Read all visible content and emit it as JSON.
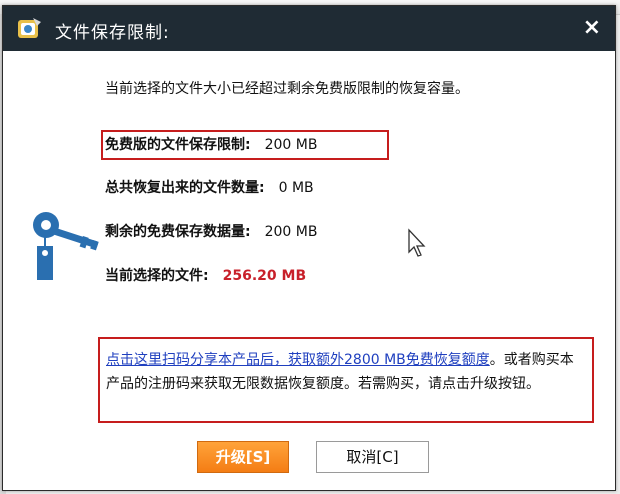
{
  "dialog": {
    "title": "文件保存限制:",
    "close_symbol": "×",
    "intro": "当前选择的文件大小已经超过剩余免费版限制的恢复容量。",
    "rows": [
      {
        "label": "免费版的文件保存限制:",
        "value": "200 MB"
      },
      {
        "label": "总共恢复出来的文件数量:",
        "value": "0 MB"
      },
      {
        "label": "剩余的免费保存数据量:",
        "value": "200 MB"
      },
      {
        "label": "当前选择的文件:",
        "value": "256.20 MB"
      }
    ],
    "info_link": "点击这里扫码分享本产品后，获取额外2800 MB免费恢复额度",
    "info_rest": "。或者购买本产品的注册码来获取无限数据恢复额度。若需购买，请点击升级按钮。",
    "upgrade_label": "升级[S]",
    "cancel_label": "取消[C]"
  },
  "colors": {
    "titlebar": "#1f2b34",
    "highlight_border": "#c61d1d",
    "selected_value": "#c8202a",
    "link": "#1f3fbf",
    "upgrade_button": "#f47d14",
    "key_icon": "#2a6fb0"
  },
  "icons": {
    "app": "app-logo-icon",
    "close": "close-icon",
    "key": "key-tag-icon",
    "cursor": "mouse-pointer-icon"
  }
}
